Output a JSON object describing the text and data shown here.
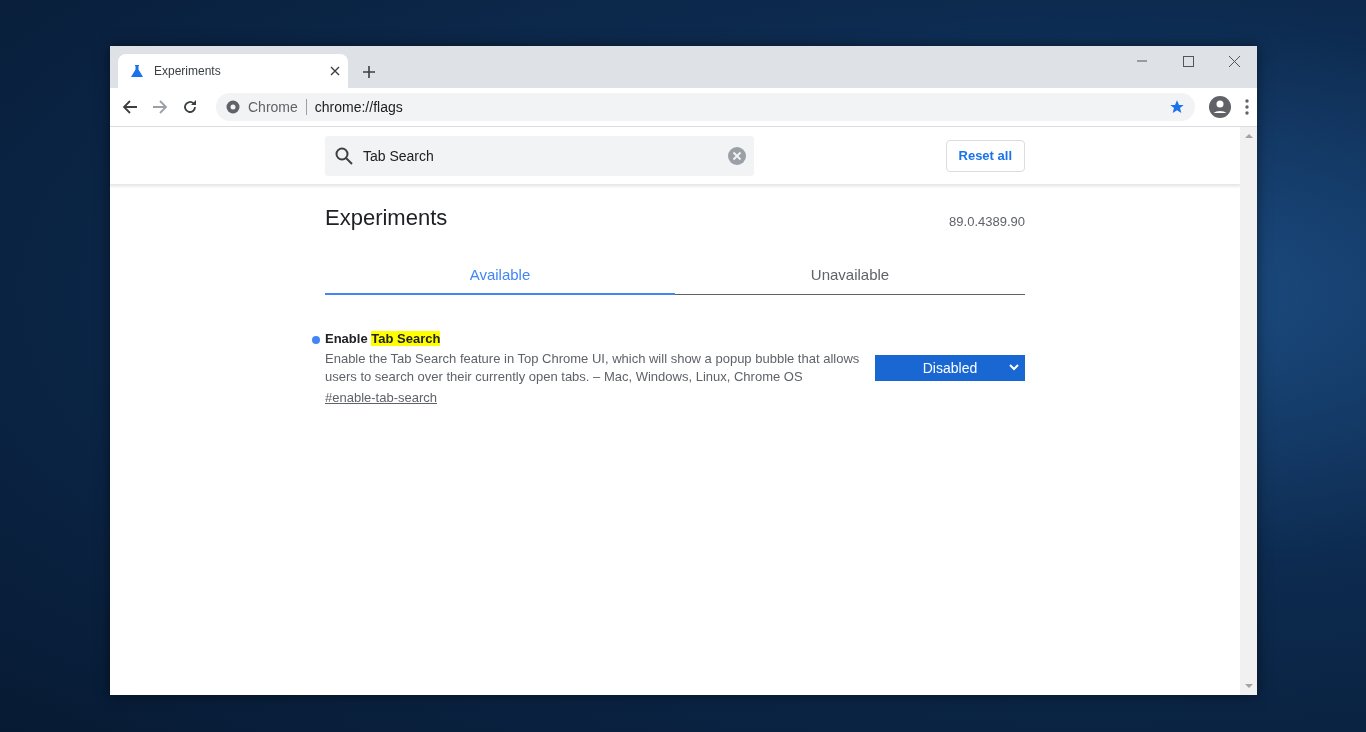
{
  "browser": {
    "tab": {
      "title": "Experiments"
    },
    "address": {
      "site": "Chrome",
      "url": "chrome://flags"
    },
    "bookmarked": true
  },
  "search": {
    "value": "Tab Search"
  },
  "reset_button": "Reset all",
  "heading": "Experiments",
  "version": "89.0.4389.90",
  "tabs": [
    {
      "label": "Available",
      "selected": true
    },
    {
      "label": "Unavailable",
      "selected": false
    }
  ],
  "flags": [
    {
      "title_prefix": "Enable",
      "title_match": "Tab Search",
      "description": "Enable the Tab Search feature in Top Chrome UI, which will show a popup bubble that allows users to search over their currently open tabs. – Mac, Windows, Linux, Chrome OS",
      "link": "#enable-tab-search",
      "value": "Disabled",
      "changed": true
    }
  ]
}
